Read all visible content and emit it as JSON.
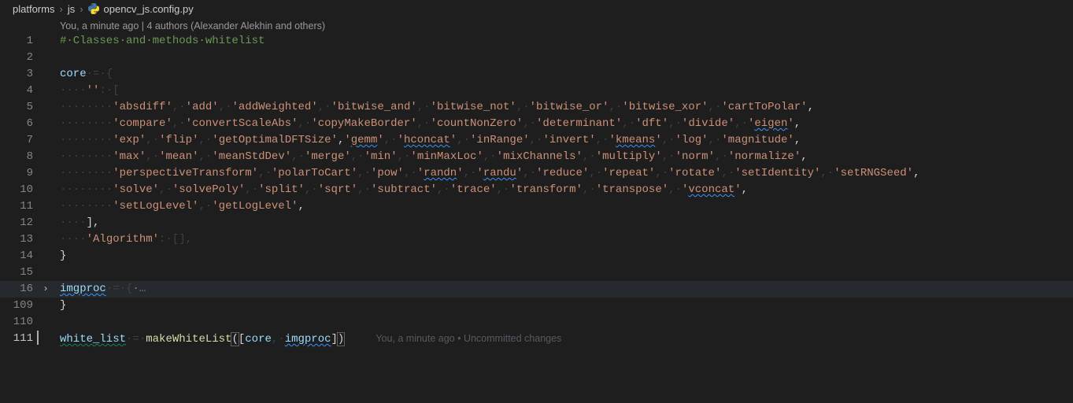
{
  "breadcrumb": {
    "seg1": "platforms",
    "seg2": "js",
    "seg3": "opencv_js.config.py"
  },
  "codelens": "You, a minute ago | 4 authors (Alexander Alekhin and others)",
  "blame": "You, a minute ago • Uncommitted changes",
  "code": {
    "comment1": "#·Classes·and·methods·whitelist",
    "l3_a": "core",
    "l3_b": "·=·{",
    "l4_a": "····",
    "l4_b": "''",
    "l4_c": ":·[",
    "dots8": "········",
    "l5": [
      "absdiff",
      "add",
      "addWeighted",
      "bitwise_and",
      "bitwise_not",
      "bitwise_or",
      "bitwise_xor",
      "cartToPolar"
    ],
    "l6": [
      "compare",
      "convertScaleAbs",
      "copyMakeBorder",
      "countNonZero",
      "determinant",
      "dft",
      "divide",
      "eigen"
    ],
    "l7": [
      "exp",
      "flip",
      "getOptimalDFTSize",
      "gemm",
      "hconcat",
      "inRange",
      "invert",
      "kmeans",
      "log",
      "magnitude"
    ],
    "l8": [
      "max",
      "mean",
      "meanStdDev",
      "merge",
      "min",
      "minMaxLoc",
      "mixChannels",
      "multiply",
      "norm",
      "normalize"
    ],
    "l9": [
      "perspectiveTransform",
      "polarToCart",
      "pow",
      "randn",
      "randu",
      "reduce",
      "repeat",
      "rotate",
      "setIdentity",
      "setRNGSeed"
    ],
    "l10": [
      "solve",
      "solvePoly",
      "split",
      "sqrt",
      "subtract",
      "trace",
      "transform",
      "transpose",
      "vconcat"
    ],
    "l11": [
      "setLogLevel",
      "getLogLevel"
    ],
    "l12_a": "····",
    "l12_b": "],",
    "l13_a": "····",
    "l13_b": "'Algorithm'",
    "l13_c": ":·[],",
    "l14": "}",
    "l16_a": "imgproc",
    "l16_b": "·=·{",
    "l109": "}",
    "l111_a": "white_list",
    "l111_b": "·=·",
    "l111_c": "makeWhiteList",
    "l111_d": "(",
    "l111_e": "[",
    "l111_f": "core",
    "l111_g": ",·",
    "l111_h": "imgproc",
    "l111_i": "]",
    "l111_j": ")"
  },
  "lines": {
    "n1": "1",
    "n2": "2",
    "n3": "3",
    "n4": "4",
    "n5": "5",
    "n6": "6",
    "n7": "7",
    "n8": "8",
    "n9": "9",
    "n10": "10",
    "n11": "11",
    "n12": "12",
    "n13": "13",
    "n14": "14",
    "n15": "15",
    "n16": "16",
    "n109": "109",
    "n110": "110",
    "n111": "111"
  }
}
